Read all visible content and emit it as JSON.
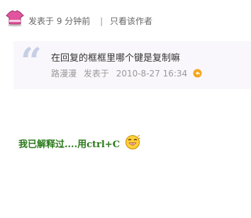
{
  "header": {
    "posted_prefix": "发表于",
    "time_ago": "9 分钟前",
    "separator": "|",
    "only_author_link": "只看该作者"
  },
  "quote": {
    "quote_mark": "“",
    "text": "在回复的框框里哪个键是复制嘛",
    "author": "路漫漫",
    "posted_label": "发表于",
    "datetime": "2010-8-27 16:34"
  },
  "reply": {
    "text": "我已解释过....用ctrl+C",
    "emoji_icon": "laughing-face-icon",
    "color": "#2a7a1a"
  },
  "colors": {
    "quote_bg": "#f9f7fb",
    "quote_mark": "#c7cfe6",
    "back_icon": "#f5a623",
    "user_icon": "#e2559e"
  }
}
